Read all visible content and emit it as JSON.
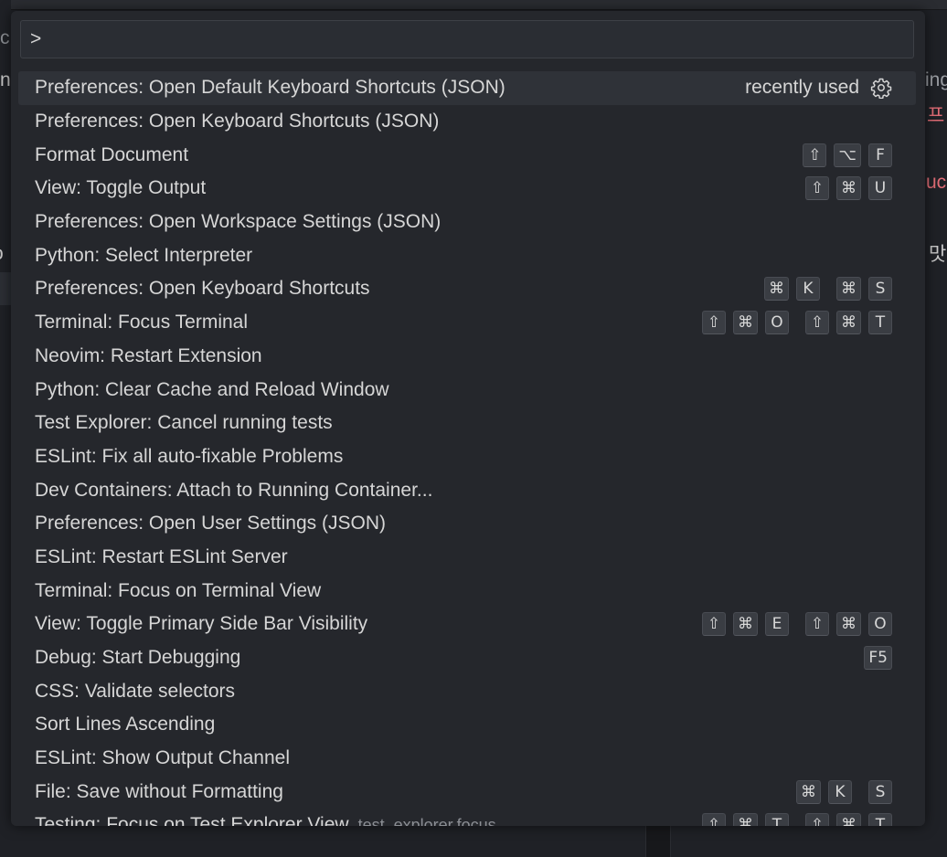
{
  "background": {
    "fragments": [
      {
        "text": "c",
        "color": "#8a8d92"
      },
      {
        "text": "n",
        "color": "#c8c8c8"
      },
      {
        "text": "o",
        "color": "#c8c8c8"
      },
      {
        "text": "ing",
        "color": "#9a9da2"
      },
      {
        "text": "프",
        "color": "#e06c75"
      },
      {
        "text": "uc",
        "color": "#e06c75"
      },
      {
        "text": "맛",
        "color": "#c8c8c8"
      }
    ]
  },
  "palette": {
    "input": {
      "value": ">",
      "placeholder": ""
    },
    "selected_meta": "recently used",
    "items": [
      {
        "label": "Preferences: Open Default Keyboard Shortcuts (JSON)",
        "desc": "",
        "chords": []
      },
      {
        "label": "Preferences: Open Keyboard Shortcuts (JSON)",
        "desc": "",
        "chords": []
      },
      {
        "label": "Format Document",
        "desc": "",
        "chords": [
          [
            "⇧",
            "⌥",
            "F"
          ]
        ]
      },
      {
        "label": "View: Toggle Output",
        "desc": "",
        "chords": [
          [
            "⇧",
            "⌘",
            "U"
          ]
        ]
      },
      {
        "label": "Preferences: Open Workspace Settings (JSON)",
        "desc": "",
        "chords": []
      },
      {
        "label": "Python: Select Interpreter",
        "desc": "",
        "chords": []
      },
      {
        "label": "Preferences: Open Keyboard Shortcuts",
        "desc": "",
        "chords": [
          [
            "⌘",
            "K"
          ],
          [
            "⌘",
            "S"
          ]
        ]
      },
      {
        "label": "Terminal: Focus Terminal",
        "desc": "",
        "chords": [
          [
            "⇧",
            "⌘",
            "O"
          ],
          [
            "⇧",
            "⌘",
            "T"
          ]
        ]
      },
      {
        "label": "Neovim: Restart Extension",
        "desc": "",
        "chords": []
      },
      {
        "label": "Python: Clear Cache and Reload Window",
        "desc": "",
        "chords": []
      },
      {
        "label": "Test Explorer: Cancel running tests",
        "desc": "",
        "chords": []
      },
      {
        "label": "ESLint: Fix all auto-fixable Problems",
        "desc": "",
        "chords": []
      },
      {
        "label": "Dev Containers: Attach to Running Container...",
        "desc": "",
        "chords": []
      },
      {
        "label": "Preferences: Open User Settings (JSON)",
        "desc": "",
        "chords": []
      },
      {
        "label": "ESLint: Restart ESLint Server",
        "desc": "",
        "chords": []
      },
      {
        "label": "Terminal: Focus on Terminal View",
        "desc": "",
        "chords": []
      },
      {
        "label": "View: Toggle Primary Side Bar Visibility",
        "desc": "",
        "chords": [
          [
            "⇧",
            "⌘",
            "E"
          ],
          [
            "⇧",
            "⌘",
            "O"
          ]
        ]
      },
      {
        "label": "Debug: Start Debugging",
        "desc": "",
        "chords": [
          [
            "F5"
          ]
        ]
      },
      {
        "label": "CSS: Validate selectors",
        "desc": "",
        "chords": []
      },
      {
        "label": "Sort Lines Ascending",
        "desc": "",
        "chords": []
      },
      {
        "label": "ESLint: Show Output Channel",
        "desc": "",
        "chords": []
      },
      {
        "label": "File: Save without Formatting",
        "desc": "",
        "chords": [
          [
            "⌘",
            "K"
          ],
          [
            "S"
          ]
        ]
      },
      {
        "label": "Testing: Focus on Test Explorer View",
        "desc": "test_explorer.focus",
        "chords": [
          [
            "⇧",
            "⌘",
            "T"
          ],
          [
            "⇧",
            "⌘",
            "T"
          ]
        ]
      }
    ]
  },
  "colors": {
    "palette_bg": "#25272c",
    "selected_row": "#2f3238",
    "keycap_bg": "#3a3d43",
    "accent_red": "#e06c75"
  },
  "icons": {
    "configure": "gear-icon"
  }
}
